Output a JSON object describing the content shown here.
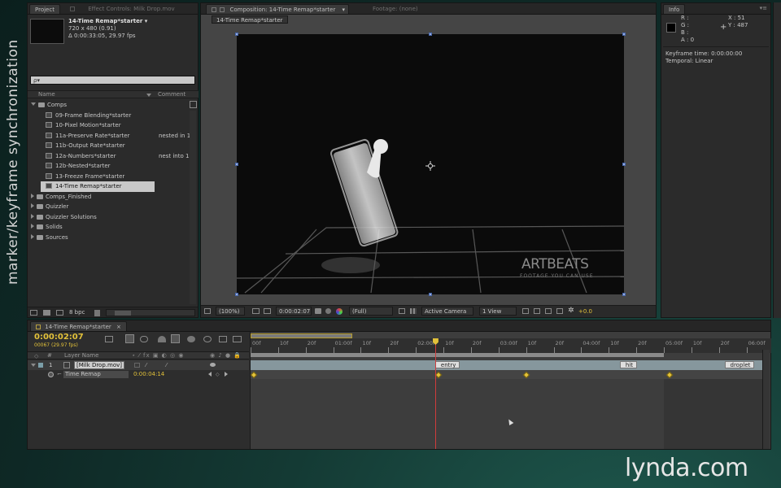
{
  "side_caption": "marker/keyframe synchronization",
  "watermark": "lynda.com",
  "project": {
    "tab_label": "Project",
    "effect_controls_tab": "Effect Controls: Milk Drop.mov",
    "comp_name": "14-Time Remap*starter ▾",
    "dimensions": "720 x 480 (0.91)",
    "duration_fps": "Δ 0:00:33:05, 29.97 fps",
    "search_placeholder": "ρ▾",
    "col_name": "Name",
    "col_comment": "Comment",
    "items": [
      {
        "label": "Comps",
        "kind": "folder-open",
        "comment": ""
      },
      {
        "label": "09-Frame Blending*starter",
        "kind": "comp",
        "comment": ""
      },
      {
        "label": "10-Pixel Motion*starter",
        "kind": "comp",
        "comment": ""
      },
      {
        "label": "11a-Preserve Rate*starter",
        "kind": "comp",
        "comment": "nested in 1"
      },
      {
        "label": "11b-Output Rate*starter",
        "kind": "comp",
        "comment": ""
      },
      {
        "label": "12a-Numbers*starter",
        "kind": "comp",
        "comment": "nest into 1"
      },
      {
        "label": "12b-Nested*starter",
        "kind": "comp",
        "comment": ""
      },
      {
        "label": "13-Freeze Frame*starter",
        "kind": "comp",
        "comment": ""
      },
      {
        "label": "14-Time Remap*starter",
        "kind": "comp-selected",
        "comment": ""
      },
      {
        "label": "Comps_Finished",
        "kind": "folder",
        "comment": ""
      },
      {
        "label": "Quizzler",
        "kind": "folder",
        "comment": ""
      },
      {
        "label": "Quizzler Solutions",
        "kind": "folder",
        "comment": ""
      },
      {
        "label": "Solids",
        "kind": "folder",
        "comment": ""
      },
      {
        "label": "Sources",
        "kind": "folder",
        "comment": ""
      }
    ],
    "bpc": "8 bpc"
  },
  "composition": {
    "tab_label": "Composition: 14-Time Remap*starter",
    "footage_tab": "Footage: (none)",
    "subtab": "14-Time Remap*starter",
    "artbeats_logo": "ARTBEATS",
    "artbeats_tagline": "FOOTAGE YOU CAN USE",
    "zoom": "(100%)",
    "timecode": "0:00:02:07",
    "resolution": "(Full)",
    "camera": "Active Camera",
    "views": "1 View",
    "exposure": "+0.0"
  },
  "info": {
    "tab_label": "Info",
    "r": "R :",
    "g": "G :",
    "b": "B :",
    "a": "A : 0",
    "x": "X : 51",
    "y": "Y : 487",
    "keyframe_time": "Keyframe time: 0:00:00:00",
    "temporal": "Temporal: Linear"
  },
  "timeline": {
    "tab_label": "14-Time Remap*starter",
    "current_time": "0:00:02:07",
    "frame_info": "00067 (29.97 fps)",
    "col_number": "#",
    "col_layer_name": "Layer Name",
    "ruler_labels": [
      "00f",
      "10f",
      "20f",
      "01:00f",
      "10f",
      "20f",
      "02:00f",
      "10f",
      "20f",
      "03:00f",
      "10f",
      "20f",
      "04:00f",
      "10f",
      "20f",
      "05:00f",
      "10f",
      "20f",
      "06:00f"
    ],
    "layer": {
      "number": "1",
      "name": "[Milk Drop.mov]",
      "property": "Time Remap",
      "property_value": "0:00:04:14"
    },
    "markers": [
      {
        "label": "entry",
        "frame": 67
      },
      {
        "label": "hit",
        "frame": 134
      },
      {
        "label": "droplet",
        "frame": 172
      }
    ],
    "keyframes_frames": [
      0,
      67,
      99,
      151
    ]
  }
}
